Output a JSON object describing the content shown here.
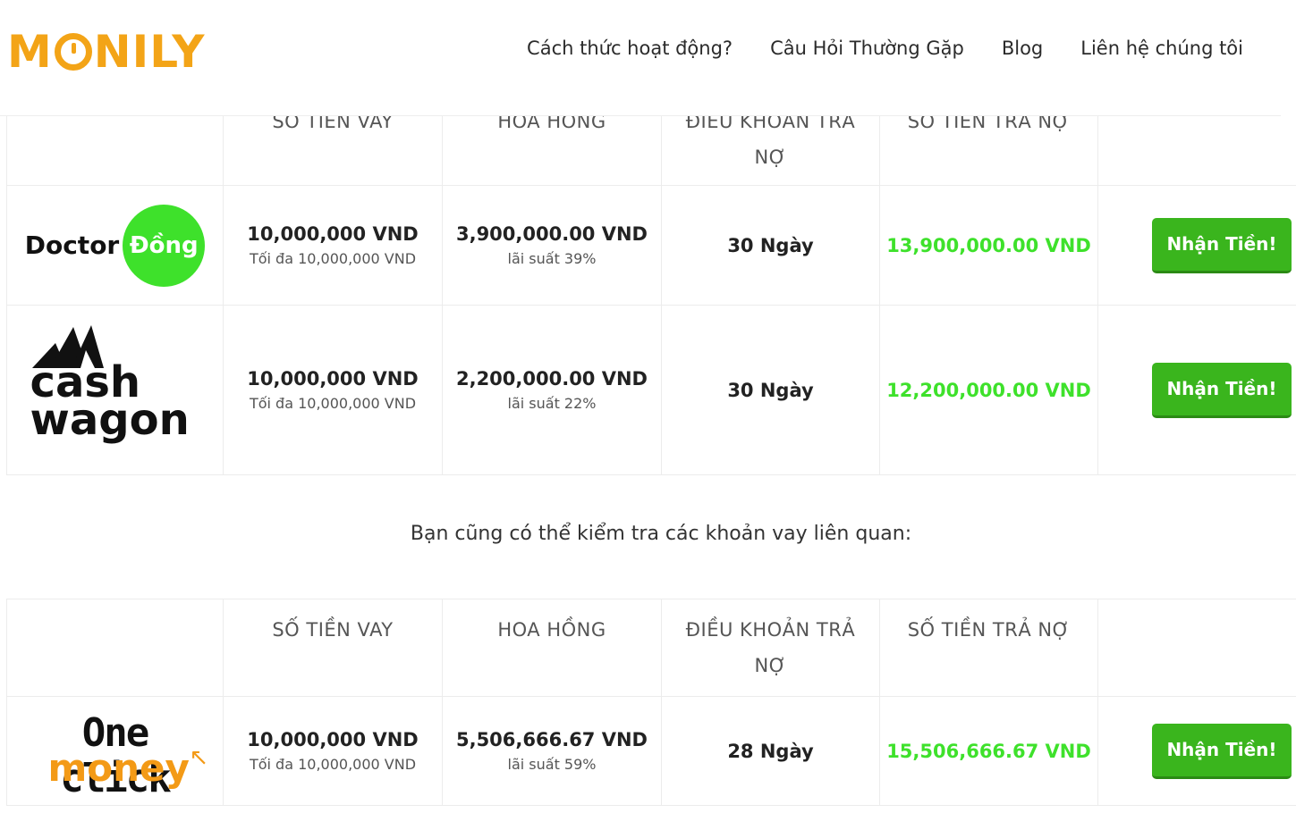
{
  "header": {
    "logo_text": "MONILY",
    "nav": [
      "Cách thức hoạt động?",
      "Câu Hỏi Thường Gặp",
      "Blog",
      "Liên hệ chúng tôi"
    ]
  },
  "table1": {
    "headers": [
      "SỐ TIỀN VAY",
      "HOA HỒNG",
      "ĐIỀU KHOẢN TRẢ NỢ",
      "SỐ TIỀN TRẢ NỢ"
    ],
    "rows": [
      {
        "brand": "Doctor Đồng",
        "brand_parts": [
          "Doctor",
          "Đồng"
        ],
        "amount": "10,000,000 VND",
        "amount_sub": "Tối đa 10,000,000 VND",
        "commission": "3,900,000.00 VND",
        "commission_sub": "lãi suất 39%",
        "term": "30 Ngày",
        "total": "13,900,000.00 VND",
        "button": "Nhận Tiền!"
      },
      {
        "brand": "cashwagon",
        "brand_parts": [
          "cash",
          "wagon"
        ],
        "amount": "10,000,000 VND",
        "amount_sub": "Tối đa 10,000,000 VND",
        "commission": "2,200,000.00 VND",
        "commission_sub": "lãi suất 22%",
        "term": "30 Ngày",
        "total": "12,200,000.00 VND",
        "button": "Nhận Tiền!"
      }
    ]
  },
  "related_text": "Bạn cũng có thể kiểm tra các khoản vay liên quan:",
  "table2": {
    "headers": [
      "SỐ TIỀN VAY",
      "HOA HỒNG",
      "ĐIỀU KHOẢN TRẢ",
      "NỢ",
      "SỐ TIỀN TRẢ NỢ"
    ],
    "rows": [
      {
        "brand": "One click money",
        "brand_parts": [
          "One click",
          "money"
        ],
        "amount": "10,000,000 VND",
        "amount_sub": "Tối đa 10,000,000 VND",
        "commission": "5,506,666.67 VND",
        "commission_sub": "lãi suất 59%",
        "term": "28 Ngày",
        "total": "15,506,666.67 VND",
        "button": "Nhận Tiền!"
      }
    ]
  },
  "colors": {
    "brand_orange": "#f3a417",
    "green_total": "#3ee12b",
    "button_green": "#3ab51d"
  }
}
